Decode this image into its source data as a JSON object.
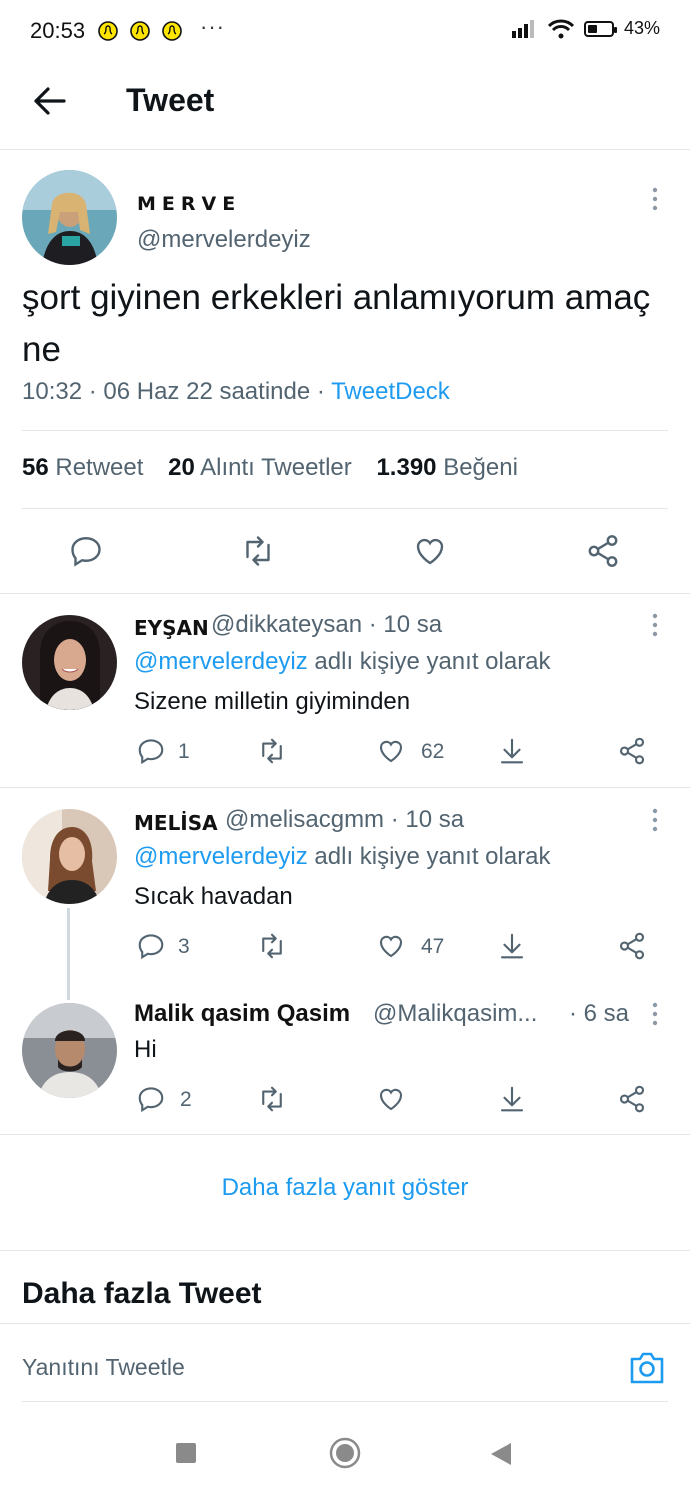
{
  "status_bar": {
    "time": "20:53",
    "dots": "···",
    "battery": "43%",
    "battery_level": 0.43
  },
  "header": {
    "title": "Tweet"
  },
  "tweet": {
    "name": "MERVE",
    "handle": "@mervelerdeyiz",
    "text": "şort giyinen erkekleri anlamıyorum amaç ne",
    "timestamp": "10:32 · 06 Haz 22 saatinde · ",
    "source": "TweetDeck",
    "stats": [
      {
        "count": "56",
        "label": "Retweet"
      },
      {
        "count": "20",
        "label": "Alıntı Tweetler"
      },
      {
        "count": "1.390",
        "label": "Beğeni"
      }
    ]
  },
  "replies": [
    {
      "name": "EYŞAN",
      "handle": "@dikkateysan · 10 sa",
      "reply_to": "@mervelerdeyiz",
      "reply_suffix": " adlı kişiye yanıt olarak",
      "text": "Sizene milletin giyiminden",
      "replies": "1",
      "likes": "62"
    },
    {
      "name": "MELİSA",
      "handle": "@melisacgmm · 10 sa",
      "reply_to": "@mervelerdeyiz",
      "reply_suffix": " adlı kişiye yanıt olarak",
      "text": "Sıcak havadan",
      "replies": "3",
      "likes": "47"
    },
    {
      "name": "Malik qasim Qasim",
      "handle": "@Malikqasim...",
      "time": "· 6 sa",
      "text": "Hi",
      "replies": "2",
      "likes": ""
    }
  ],
  "show_more": "Daha fazla yanıt göster",
  "more_tweets": "Daha fazla Tweet",
  "reply_placeholder": "Yanıtını Tweetle",
  "colors": {
    "accent": "#1d9bf0",
    "text": "#0f1419",
    "secondary": "#536471",
    "divider": "#e3e7ea"
  }
}
